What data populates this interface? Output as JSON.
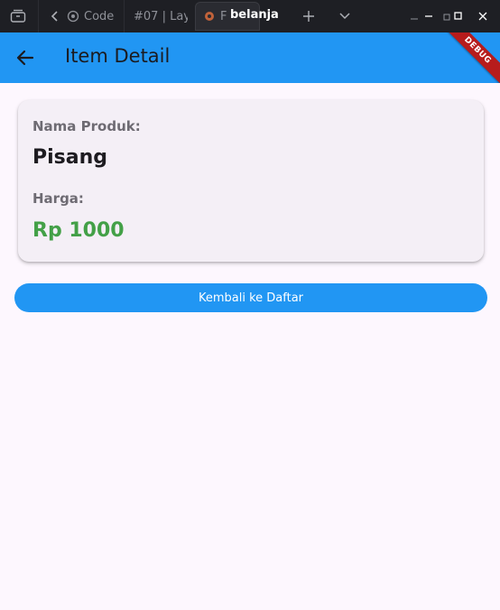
{
  "window": {
    "title": "belanja",
    "tabs": [
      {
        "label": "Code"
      },
      {
        "label": "#07 | Lay"
      },
      {
        "label": "F"
      }
    ]
  },
  "app_bar": {
    "title": "Item Detail",
    "debug_banner": "DEBUG",
    "color": "#2196f3"
  },
  "detail": {
    "name_label": "Nama Produk:",
    "name_value": "Pisang",
    "price_label": "Harga:",
    "price_value": "Rp 1000",
    "price_color": "#43a047"
  },
  "actions": {
    "back_button_label": "Kembali ke Daftar"
  }
}
